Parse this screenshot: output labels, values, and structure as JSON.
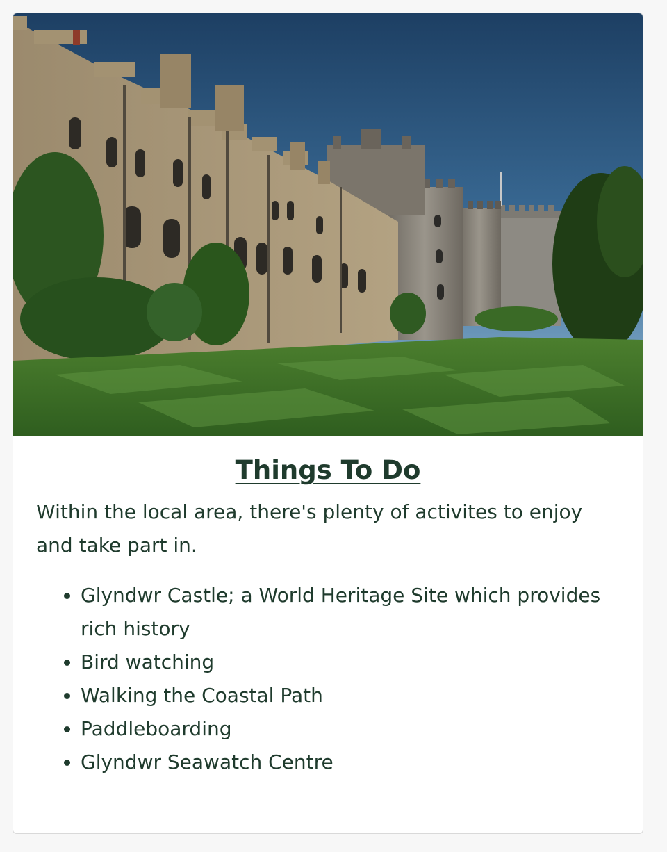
{
  "card": {
    "image_alt": "Castle exterior with lawn",
    "title": "Things To Do",
    "intro": "Within the local area, there's plenty of activites to enjoy and take part in.",
    "activities": [
      "Glyndwr Castle; a World Heritage Site which provides rich history",
      "Bird watching",
      "Walking the Coastal Path",
      "Paddleboarding",
      "Glyndwr Seawatch Centre"
    ]
  },
  "colors": {
    "text": "#1f3b2d",
    "card_bg": "#ffffff",
    "page_bg": "#f7f7f7",
    "border": "#d9d9d9"
  }
}
